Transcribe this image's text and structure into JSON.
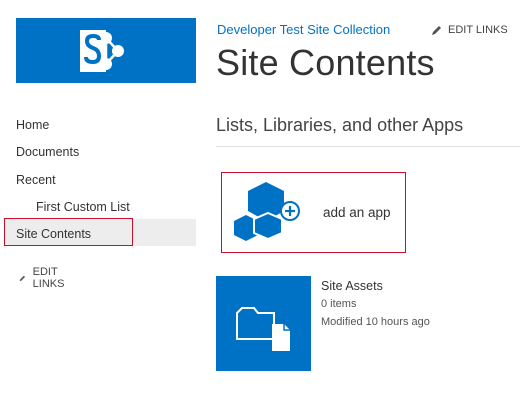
{
  "brand": {
    "color": "#0072c6",
    "highlight_color": "#c8102e",
    "logo_icon": "sharepoint-logo-icon"
  },
  "header": {
    "site_title": "Developer Test Site Collection",
    "edit_links": "EDIT LINKS",
    "page_title": "Site Contents"
  },
  "quicklaunch": {
    "items": [
      {
        "label": "Home"
      },
      {
        "label": "Documents"
      },
      {
        "label": "Recent"
      },
      {
        "label": "First Custom List"
      },
      {
        "label": "Site Contents",
        "selected": true
      }
    ],
    "edit_links": "EDIT LINKS"
  },
  "main": {
    "section_heading": "Lists, Libraries, and other Apps",
    "add_app": {
      "label": "add an app",
      "icon": "add-app-icon"
    },
    "apps": [
      {
        "name": "Site Assets",
        "count": "0 items",
        "modified": "Modified 10 hours ago",
        "icon": "document-library-icon"
      }
    ]
  }
}
